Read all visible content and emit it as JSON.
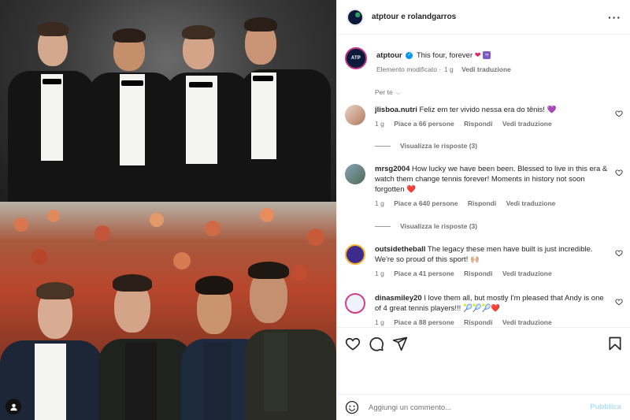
{
  "header": {
    "title": "atptour e rolandgarros",
    "more_icon": "more-horizontal-icon"
  },
  "caption": {
    "username": "atptour",
    "text": "This four, forever",
    "status": "Elemento modificato",
    "time": "1 g",
    "translate": "Vedi traduzione"
  },
  "sort_label": "Per te",
  "comments": [
    {
      "username": "jlisboa.nutri",
      "text": "Feliz em ter vivido nessa era do tênis! 💜",
      "time": "1 g",
      "likes": "Piace a 66 persone",
      "reply": "Rispondi",
      "translate": "Vedi traduzione",
      "replies": "Visualizza le risposte (3)"
    },
    {
      "username": "mrsg2004",
      "text": "How lucky we have been been. Blessed to live in this era & watch them change tennis forever! Moments in history not soon forgotten ❤️",
      "time": "1 g",
      "likes": "Piace a 640 persone",
      "reply": "Rispondi",
      "translate": "Vedi traduzione",
      "replies": "Visualizza le risposte (3)"
    },
    {
      "username": "outsidetheball",
      "text": "The legacy these men have built is just incredible. We're so proud of this sport! 🙌🏼",
      "time": "1 g",
      "likes": "Piace a 41 persone",
      "reply": "Rispondi",
      "translate": "Vedi traduzione"
    },
    {
      "username": "dinasmiley20",
      "text": "I love them all, but mostly I'm pleased that Andy is one of 4 great tennis players!!! 🎾🎾🎾❤️",
      "time": "1 g",
      "likes": "Piace a 88 persone",
      "reply": "Rispondi",
      "translate": "Vedi traduzione"
    }
  ],
  "add_comment": {
    "placeholder": "Aggiungi un commento...",
    "publish": "Pubblica"
  },
  "colors": {
    "verified": "#0095f6",
    "publish": "#b2dffc",
    "secondary_text": "#737373"
  }
}
